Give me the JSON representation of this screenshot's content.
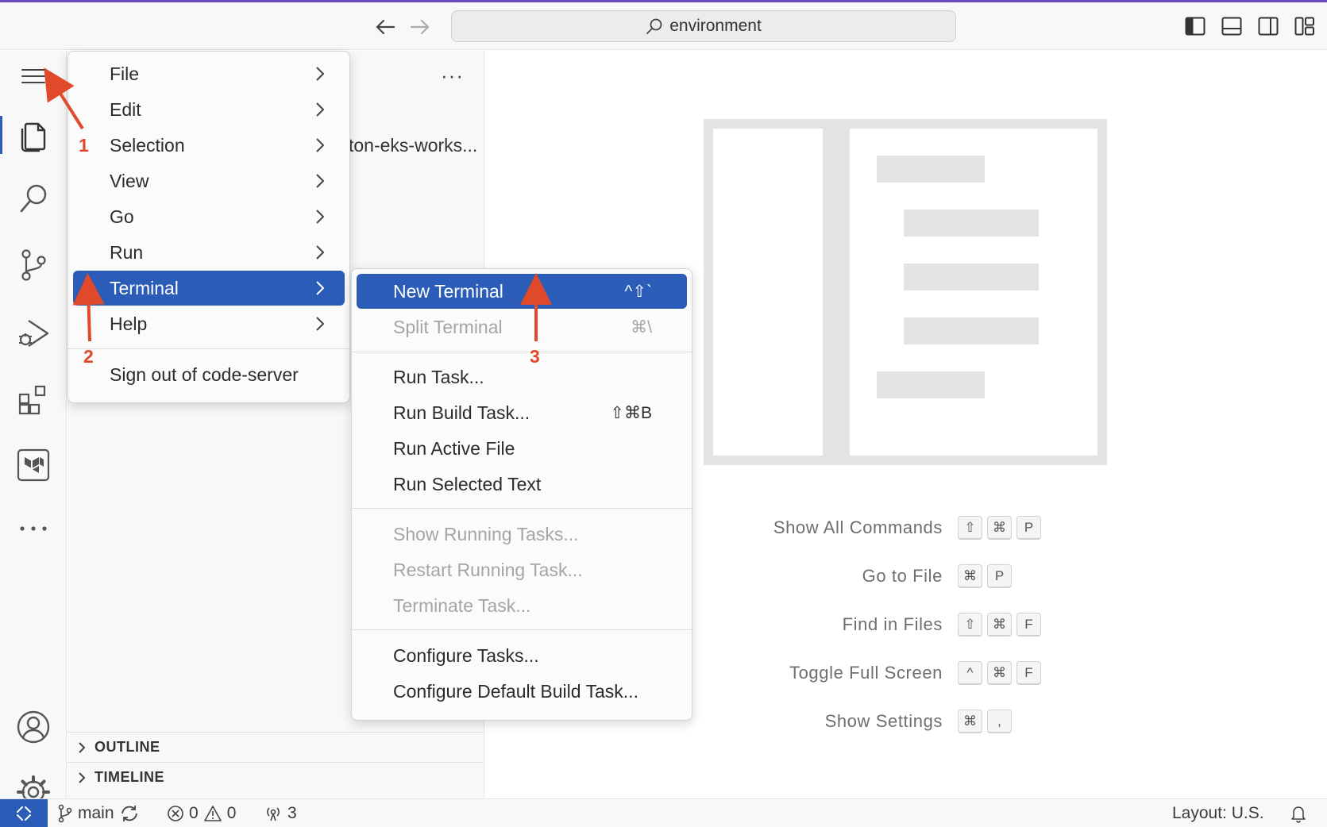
{
  "titlebar": {
    "search_text": "environment"
  },
  "sidebar": {
    "folder_text": "ton-eks-works...",
    "more_label": "···",
    "sections": [
      {
        "label": "OUTLINE"
      },
      {
        "label": "TIMELINE"
      }
    ]
  },
  "main_menu": {
    "items": [
      {
        "label": "File"
      },
      {
        "label": "Edit"
      },
      {
        "label": "Selection"
      },
      {
        "label": "View"
      },
      {
        "label": "Go"
      },
      {
        "label": "Run"
      },
      {
        "label": "Terminal"
      },
      {
        "label": "Help"
      }
    ],
    "signout_label": "Sign out of code-server",
    "highlighted": "Terminal"
  },
  "terminal_menu": {
    "items": [
      {
        "label": "New Terminal",
        "shortcut": "^⇧`"
      },
      {
        "label": "Split Terminal",
        "shortcut": "⌘\\"
      },
      {
        "label": "Run Task...",
        "shortcut": ""
      },
      {
        "label": "Run Build Task...",
        "shortcut": "⇧⌘B"
      },
      {
        "label": "Run Active File",
        "shortcut": ""
      },
      {
        "label": "Run Selected Text",
        "shortcut": ""
      },
      {
        "label": "Show Running Tasks...",
        "shortcut": ""
      },
      {
        "label": "Restart Running Task...",
        "shortcut": ""
      },
      {
        "label": "Terminate Task...",
        "shortcut": ""
      },
      {
        "label": "Configure Tasks...",
        "shortcut": ""
      },
      {
        "label": "Configure Default Build Task...",
        "shortcut": ""
      }
    ],
    "highlighted": "New Terminal",
    "disabled": [
      "Split Terminal",
      "Show Running Tasks...",
      "Restart Running Task...",
      "Terminate Task..."
    ]
  },
  "shortcuts": [
    {
      "label": "Show All Commands",
      "keys": [
        "⇧",
        "⌘",
        "P"
      ]
    },
    {
      "label": "Go to File",
      "keys": [
        "⌘",
        "P"
      ]
    },
    {
      "label": "Find in Files",
      "keys": [
        "⇧",
        "⌘",
        "F"
      ]
    },
    {
      "label": "Toggle Full Screen",
      "keys": [
        "^",
        "⌘",
        "F"
      ]
    },
    {
      "label": "Show Settings",
      "keys": [
        "⌘",
        ","
      ]
    }
  ],
  "statusbar": {
    "branch": "main",
    "errors": "0",
    "warnings": "0",
    "ports": "3",
    "layout": "Layout: U.S."
  },
  "annotations": [
    "1",
    "2",
    "3"
  ],
  "colors": {
    "accent": "#2a5cb8",
    "annotation": "#e04a2a",
    "topline": "#6b4bbf"
  }
}
